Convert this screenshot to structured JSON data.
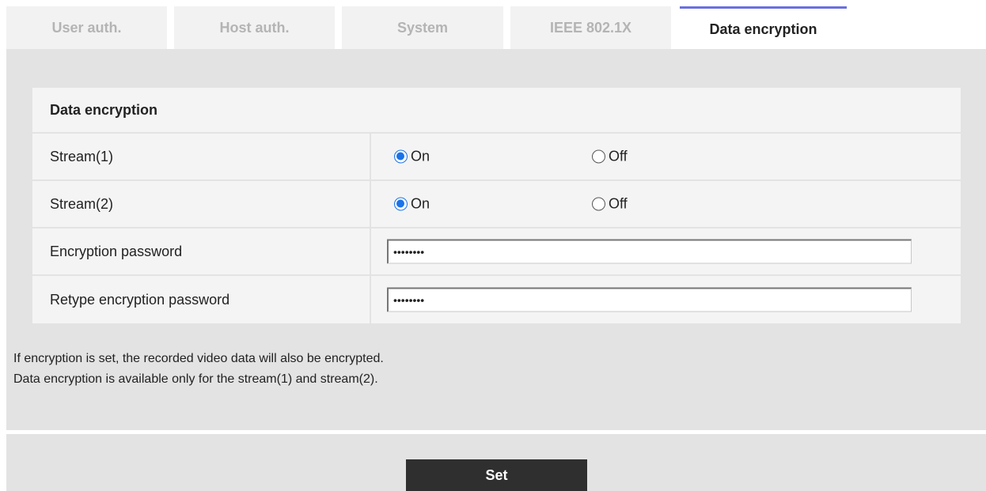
{
  "tabs": [
    {
      "label": "User auth.",
      "active": false
    },
    {
      "label": "Host auth.",
      "active": false
    },
    {
      "label": "System",
      "active": false
    },
    {
      "label": "IEEE 802.1X",
      "active": false
    },
    {
      "label": "Data encryption",
      "active": true
    }
  ],
  "section": {
    "title": "Data encryption"
  },
  "stream1": {
    "label": "Stream(1)",
    "on_label": "On",
    "off_label": "Off",
    "selected": "On"
  },
  "stream2": {
    "label": "Stream(2)",
    "on_label": "On",
    "off_label": "Off",
    "selected": "On"
  },
  "encryption_password": {
    "label": "Encryption password",
    "value": "••••••••"
  },
  "retype_password": {
    "label": "Retype encryption password",
    "value": "••••••••"
  },
  "notes": [
    "If encryption is set, the recorded video data will also be encrypted.",
    "Data encryption is available only for the stream(1) and stream(2)."
  ],
  "set_button": {
    "label": "Set"
  },
  "colors": {
    "accent": "#1a73e8",
    "active_tab_border": "#6a6ee0",
    "button_bg": "#2f2f2f"
  }
}
